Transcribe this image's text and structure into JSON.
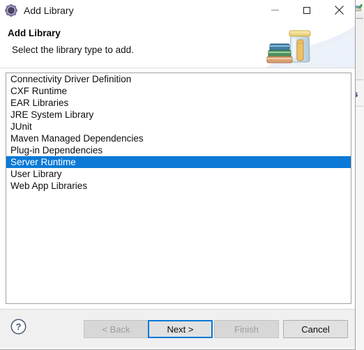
{
  "window": {
    "title": "Add Library",
    "icon": "gear-icon",
    "controls": {
      "minimize": "minimize-icon",
      "maximize": "maximize-icon",
      "close": "close-icon"
    }
  },
  "header": {
    "title": "Add Library",
    "description": "Select the library type to add.",
    "art": "library-jar-books-icon"
  },
  "list": {
    "name": "library-type-list",
    "selected_index": 7,
    "items": [
      "Connectivity Driver Definition",
      "CXF Runtime",
      "EAR Libraries",
      "JRE System Library",
      "JUnit",
      "Maven Managed Dependencies",
      "Plug-in Dependencies",
      "Server Runtime",
      "User Library",
      "Web App Libraries"
    ]
  },
  "footer": {
    "help": "help-icon",
    "buttons": [
      {
        "label": "< Back",
        "name": "back-button",
        "enabled": false,
        "default": false
      },
      {
        "label": "Next >",
        "name": "next-button",
        "enabled": true,
        "default": true
      },
      {
        "label": "Finish",
        "name": "finish-button",
        "enabled": false,
        "default": false
      },
      {
        "label": "Cancel",
        "name": "cancel-button",
        "enabled": true,
        "default": false
      }
    ]
  },
  "background": {
    "partial_text": "es"
  },
  "colors": {
    "selection_blue": "#0a7ad6",
    "focus_blue": "#0078d7",
    "footer_bg": "#f0f0f0",
    "dialog_bg": "#ffffff",
    "border_gray": "#a0a0a0"
  }
}
